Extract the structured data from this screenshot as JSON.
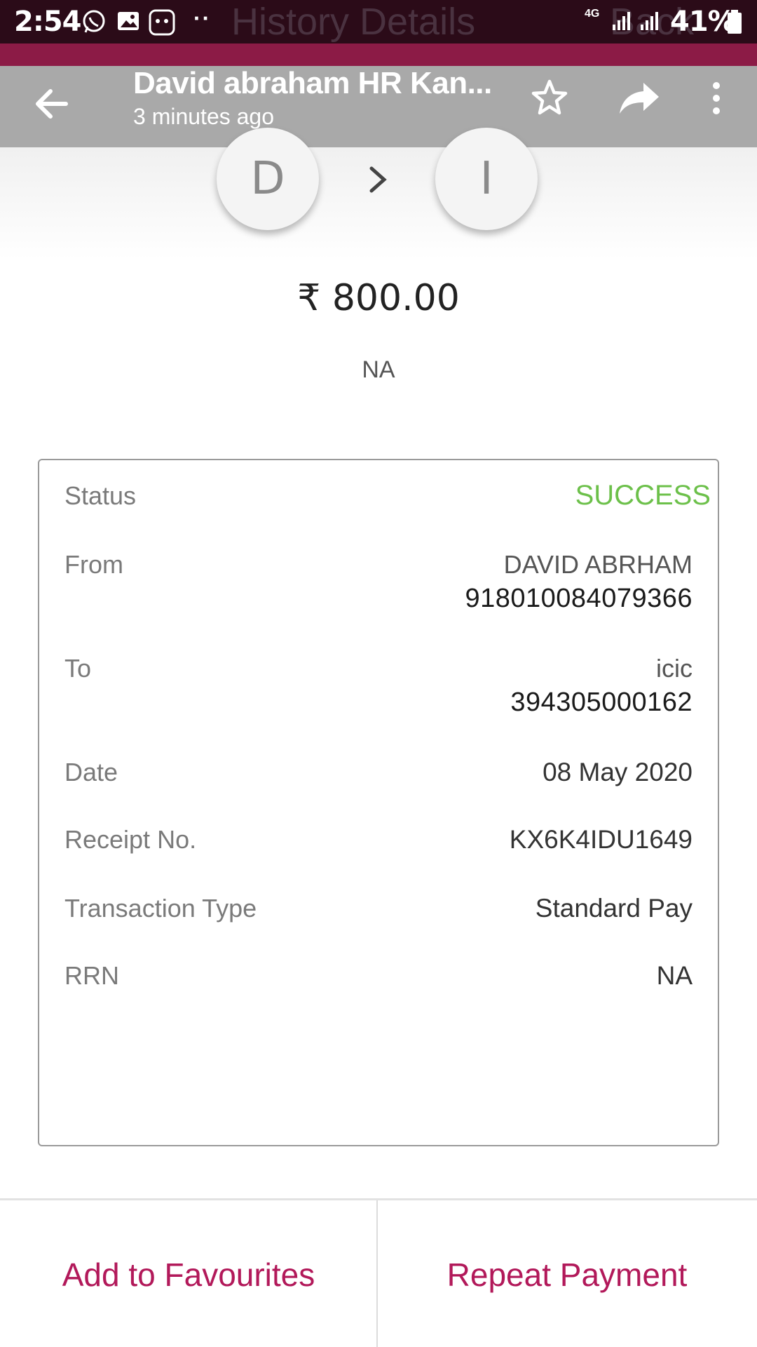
{
  "status_bar": {
    "time": "2:54",
    "network": "4G",
    "battery": "41%",
    "background_title": "History Details",
    "background_right": "Back"
  },
  "top_bar": {
    "title": "David abraham HR Kan...",
    "subtitle": "3 minutes ago",
    "icons": [
      "back-arrow-icon",
      "star-icon",
      "share-icon",
      "more-vert-icon"
    ]
  },
  "transfer": {
    "from_initial": "D",
    "to_initial": "I",
    "amount": "₹ 800.00",
    "remark": "NA"
  },
  "details": {
    "status_label": "Status",
    "status_value": "SUCCESS",
    "from_label": "From",
    "from_name": "DAVID ABRHAM",
    "from_account": "918010084079366",
    "to_label": "To",
    "to_name": "icic",
    "to_account": "394305000162",
    "date_label": "Date",
    "date_value": "08 May 2020",
    "receipt_label": "Receipt No.",
    "receipt_value": "KX6K4IDU1649",
    "type_label": "Transaction Type",
    "type_value": "Standard Pay",
    "rrn_label": "RRN",
    "rrn_value": "NA"
  },
  "actions": {
    "favourites": "Add to Favourites",
    "repeat": "Repeat Payment"
  },
  "colors": {
    "status_bar": "#2b0b18",
    "accent_strip": "#8c1b46",
    "top_bar": "#a9a9a9",
    "success": "#6cc04a",
    "action_text": "#b2195a"
  }
}
